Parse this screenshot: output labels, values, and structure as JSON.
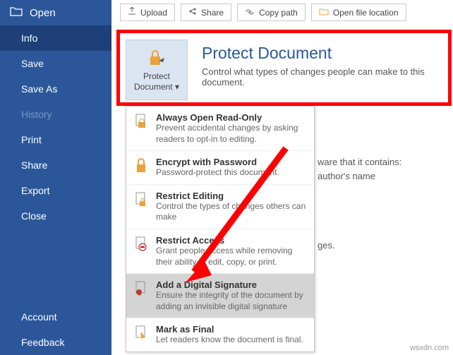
{
  "sidebar": {
    "open": "Open",
    "items": [
      "Info",
      "Save",
      "Save As",
      "History",
      "Print",
      "Share",
      "Export",
      "Close"
    ],
    "bottom": [
      "Account",
      "Feedback"
    ]
  },
  "topbar": {
    "upload": "Upload",
    "share": "Share",
    "copypath": "Copy path",
    "openloc": "Open file location"
  },
  "protect": {
    "tile_label": "Protect Document",
    "tile_chevron": "▾",
    "title": "Protect Document",
    "subtitle": "Control what types of changes people can make to this document."
  },
  "menu": [
    {
      "title": "Always Open Read-Only",
      "desc": "Prevent accidental changes by asking readers to opt-in to editing."
    },
    {
      "title": "Encrypt with Password",
      "desc": "Password-protect this document."
    },
    {
      "title": "Restrict Editing",
      "desc": "Control the types of changes others can make"
    },
    {
      "title": "Restrict Access",
      "desc": "Grant people access while removing their ability to edit, copy, or print."
    },
    {
      "title": "Add a Digital Signature",
      "desc": "Ensure the integrity of the document by adding an invisible digital signature"
    },
    {
      "title": "Mark as Final",
      "desc": "Let readers know the document is final."
    }
  ],
  "side": {
    "line1": "ware that it contains:",
    "line2": "author's name",
    "line3": "ges."
  },
  "watermark": "wsxdn.com"
}
